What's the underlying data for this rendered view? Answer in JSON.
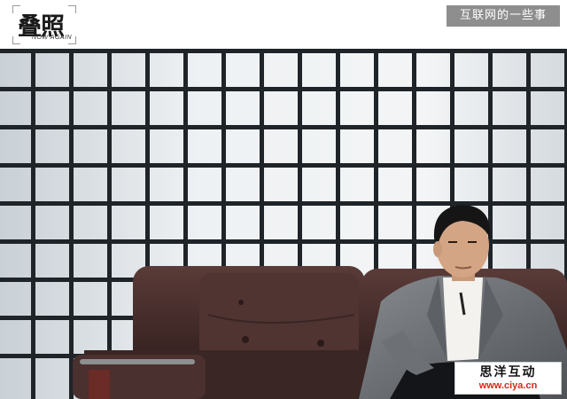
{
  "header": {
    "logo": {
      "text": "叠照",
      "subtitle": "NOW AGAIN"
    },
    "series_tag": "互联网的一些事"
  },
  "photo": {
    "subject": "man-in-grey-blazer-on-leather-sofa",
    "colors": {
      "wall": "#e9edf0",
      "grid": "#1f2429",
      "sofa": "#4a3230",
      "blazer": "#6f7378"
    }
  },
  "watermark": {
    "title": "思洋互动",
    "url": "www.ciya.cn"
  }
}
